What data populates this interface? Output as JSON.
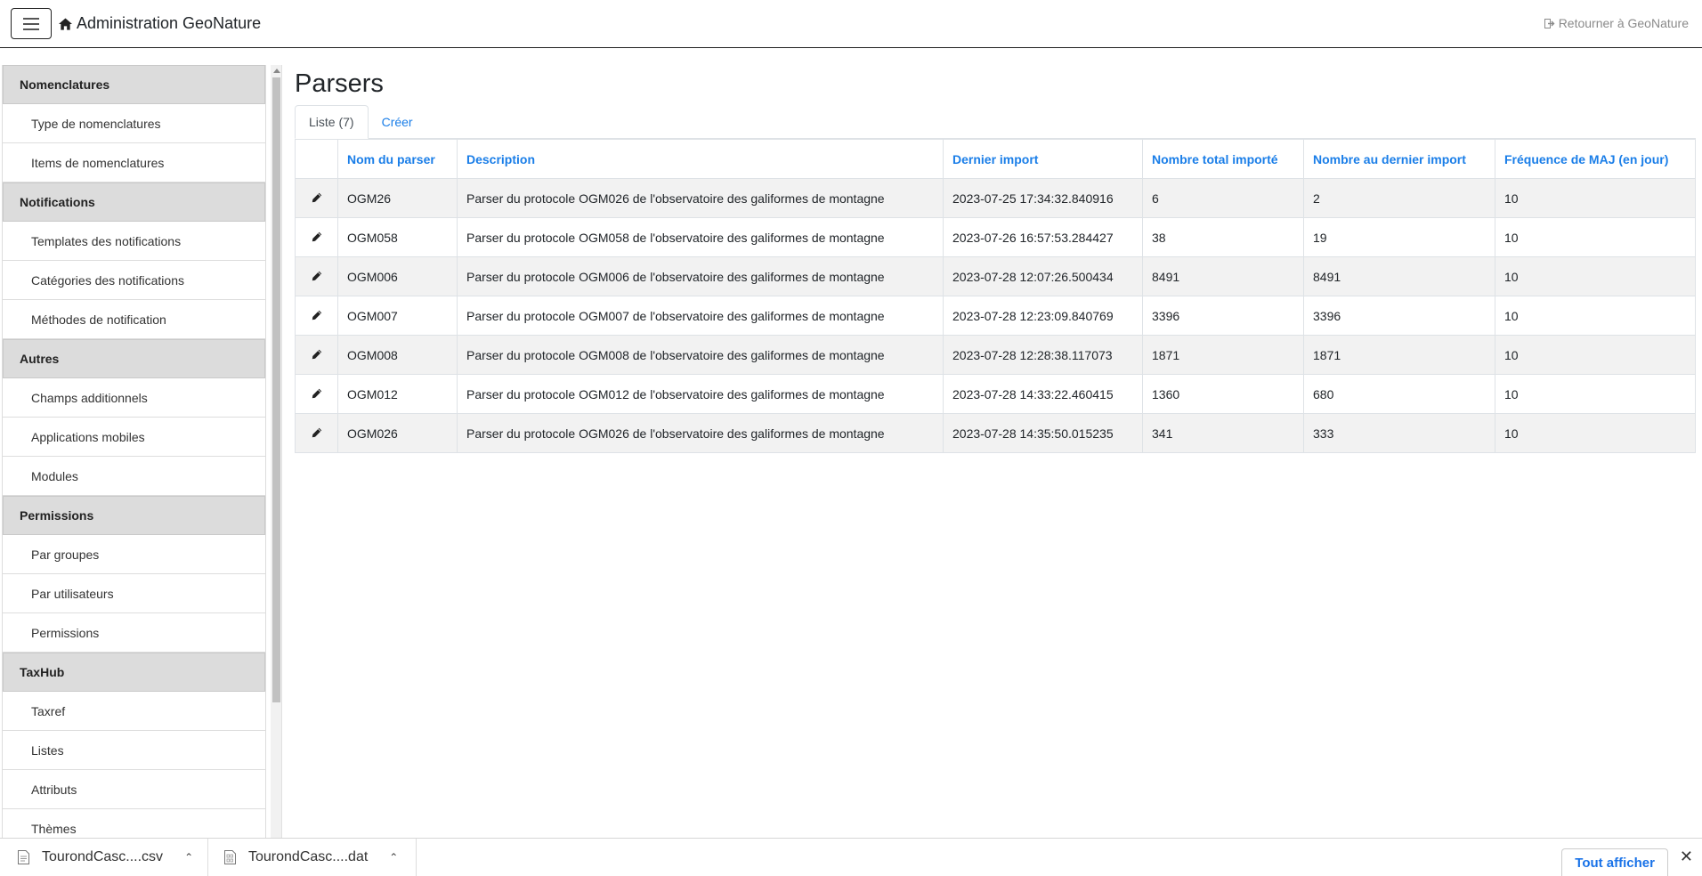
{
  "header": {
    "title": "Administration GeoNature",
    "back_label": "Retourner à GeoNature"
  },
  "sidebar": {
    "sections": [
      {
        "title": "Nomenclatures",
        "items": [
          "Type de nomenclatures",
          "Items de nomenclatures"
        ]
      },
      {
        "title": "Notifications",
        "items": [
          "Templates des notifications",
          "Catégories des notifications",
          "Méthodes de notification"
        ]
      },
      {
        "title": "Autres",
        "items": [
          "Champs additionnels",
          "Applications mobiles",
          "Modules"
        ]
      },
      {
        "title": "Permissions",
        "items": [
          "Par groupes",
          "Par utilisateurs",
          "Permissions"
        ]
      },
      {
        "title": "TaxHub",
        "items": [
          "Taxref",
          "Listes",
          "Attributs",
          "Thèmes"
        ]
      }
    ]
  },
  "main": {
    "title": "Parsers",
    "tabs": [
      {
        "label": "Liste (7)",
        "active": true
      },
      {
        "label": "Créer",
        "active": false
      }
    ],
    "table": {
      "columns": [
        "Nom du parser",
        "Description",
        "Dernier import",
        "Nombre total importé",
        "Nombre au dernier import",
        "Fréquence de MAJ (en jour)"
      ],
      "rows": [
        [
          "OGM26",
          "Parser du protocole OGM026 de l'observatoire des galiformes de montagne",
          "2023-07-25 17:34:32.840916",
          "6",
          "2",
          "10"
        ],
        [
          "OGM058",
          "Parser du protocole OGM058 de l'observatoire des galiformes de montagne",
          "2023-07-26 16:57:53.284427",
          "38",
          "19",
          "10"
        ],
        [
          "OGM006",
          "Parser du protocole OGM006 de l'observatoire des galiformes de montagne",
          "2023-07-28 12:07:26.500434",
          "8491",
          "8491",
          "10"
        ],
        [
          "OGM007",
          "Parser du protocole OGM007 de l'observatoire des galiformes de montagne",
          "2023-07-28 12:23:09.840769",
          "3396",
          "3396",
          "10"
        ],
        [
          "OGM008",
          "Parser du protocole OGM008 de l'observatoire des galiformes de montagne",
          "2023-07-28 12:28:38.117073",
          "1871",
          "1871",
          "10"
        ],
        [
          "OGM012",
          "Parser du protocole OGM012 de l'observatoire des galiformes de montagne",
          "2023-07-28 14:33:22.460415",
          "1360",
          "680",
          "10"
        ],
        [
          "OGM026",
          "Parser du protocole OGM026 de l'observatoire des galiformes de montagne",
          "2023-07-28 14:35:50.015235",
          "341",
          "333",
          "10"
        ]
      ]
    }
  },
  "downloads": {
    "items": [
      {
        "name": "TourondCasc....csv",
        "icon": "document-icon"
      },
      {
        "name": "TourondCasc....dat",
        "icon": "binary-file-icon"
      }
    ],
    "show_all_label": "Tout afficher"
  },
  "colors": {
    "link": "#1a7ee8",
    "category_bg": "#dcdcdc",
    "stripe": "#f2f2f2"
  }
}
